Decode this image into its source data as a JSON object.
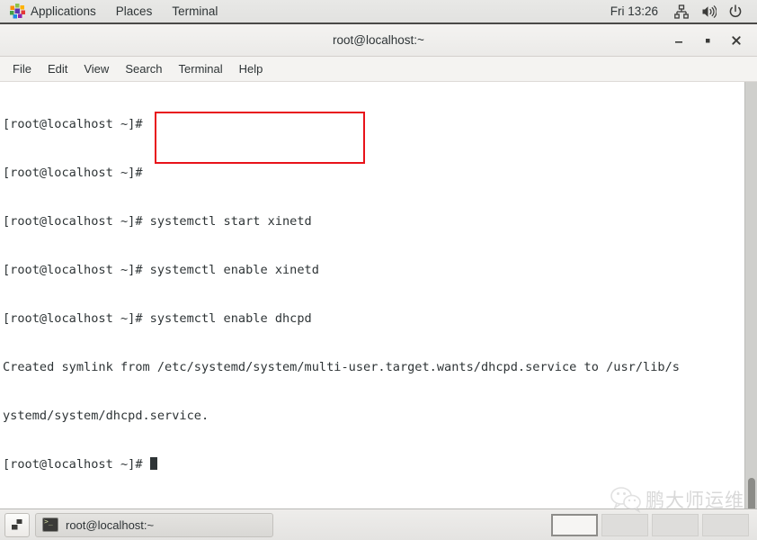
{
  "top_panel": {
    "applications_label": "Applications",
    "places_label": "Places",
    "terminal_label": "Terminal",
    "clock": "Fri 13:26",
    "tray": [
      {
        "name": "network-icon",
        "label": "network-icon"
      },
      {
        "name": "volume-icon",
        "label": "volume-icon"
      },
      {
        "name": "power-icon",
        "label": "power-icon"
      }
    ],
    "apps_icon_name": "applications-pinwheel-icon"
  },
  "window": {
    "title": "root@localhost:~",
    "buttons": {
      "minimize": "minimize-icon",
      "maximize": "maximize-icon",
      "close": "close-icon"
    },
    "menu": [
      {
        "label": "File"
      },
      {
        "label": "Edit"
      },
      {
        "label": "View"
      },
      {
        "label": "Search"
      },
      {
        "label": "Terminal"
      },
      {
        "label": "Help"
      }
    ]
  },
  "terminal": {
    "prompt": "[root@localhost ~]#",
    "lines": [
      "[root@localhost ~]# ",
      "[root@localhost ~]# ",
      "[root@localhost ~]# systemctl start xinetd",
      "[root@localhost ~]# systemctl enable xinetd",
      "[root@localhost ~]# systemctl enable dhcpd",
      "Created symlink from /etc/systemd/system/multi-user.target.wants/dhcpd.service to /usr/lib/s",
      "ystemd/system/dhcpd.service.",
      "[root@localhost ~]# "
    ],
    "commands_highlighted": [
      "systemctl start xinetd",
      "systemctl enable xinetd",
      "systemctl enable dhcpd"
    ],
    "annotation_color": "#e8131a",
    "foreground_color": "#2e3436",
    "background_color": "#ffffff",
    "cursor": "block-cursor"
  },
  "bottom_panel": {
    "show_desktop_icon": "window-list-icon",
    "task": {
      "icon": "terminal-icon",
      "label": "root@localhost:~"
    },
    "workspaces": [
      {
        "name": "workspace-1",
        "active": true
      },
      {
        "name": "workspace-2",
        "active": false
      },
      {
        "name": "workspace-3",
        "active": false
      },
      {
        "name": "workspace-4",
        "active": false
      }
    ]
  },
  "watermark": {
    "icon": "wechat-logo-icon",
    "text": "鹏大师运维"
  }
}
